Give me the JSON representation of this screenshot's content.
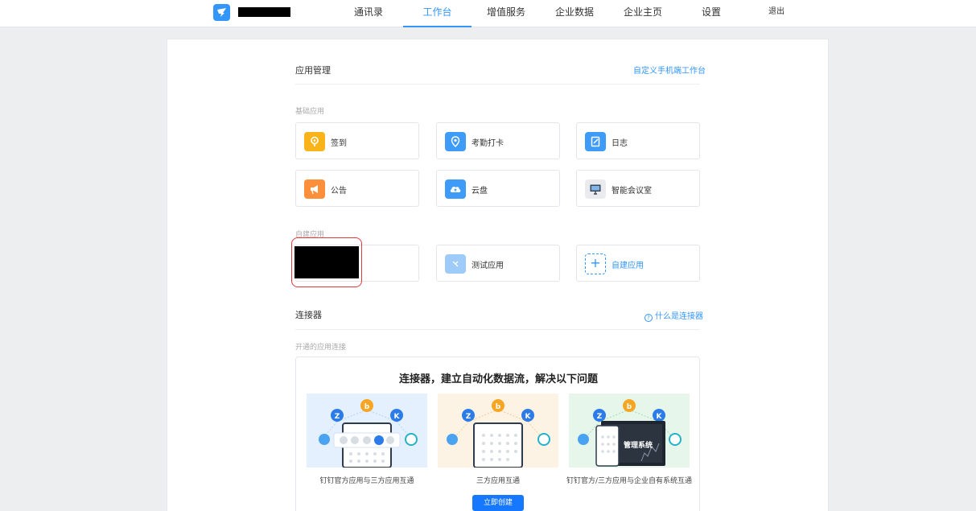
{
  "nav": {
    "items": [
      "通讯录",
      "工作台",
      "增值服务",
      "企业数据",
      "企业主页",
      "设置"
    ],
    "active_index": 1,
    "logout": "退出"
  },
  "app_mgmt": {
    "title": "应用管理",
    "customize_link": "自定义手机端工作台",
    "basic_label": "基础应用",
    "basic_apps": [
      {
        "label": "签到",
        "icon": "location-pin-icon",
        "color": "#f9b31b"
      },
      {
        "label": "考勤打卡",
        "icon": "location-marker-icon",
        "color": "#3e9bf7"
      },
      {
        "label": "日志",
        "icon": "journal-icon",
        "color": "#3e9bf7"
      },
      {
        "label": "公告",
        "icon": "megaphone-icon",
        "color": "#fd8f3a"
      },
      {
        "label": "云盘",
        "icon": "cloud-upload-icon",
        "color": "#3e9bf7"
      },
      {
        "label": "智能会议室",
        "icon": "monitor-icon",
        "color": "#e9ebee"
      }
    ],
    "custom_label": "自建应用",
    "custom_apps": [
      {
        "label": "测试应用",
        "icon": "app-placeholder-icon",
        "color": "#9ecbf8"
      }
    ],
    "create_app": "自建应用"
  },
  "connector": {
    "title": "连接器",
    "help_link": "什么是连接器",
    "sub_label": "开通的应用连接",
    "promo_title": "连接器，建立自动化数据流，解决以下问题",
    "cards": [
      {
        "caption": "钉钉官方应用与三方应用互通",
        "bg": "#e4f0fd"
      },
      {
        "caption": "三方应用互通",
        "bg": "#fdf3e4"
      },
      {
        "caption": "钉钉官方/三方应用与企业自有系统互通",
        "bg": "#e6f6ea",
        "screen_text": "管理系统"
      }
    ],
    "cta": "立即创建"
  },
  "colors": {
    "accent": "#3296fa",
    "highlight": "#e0393e"
  }
}
